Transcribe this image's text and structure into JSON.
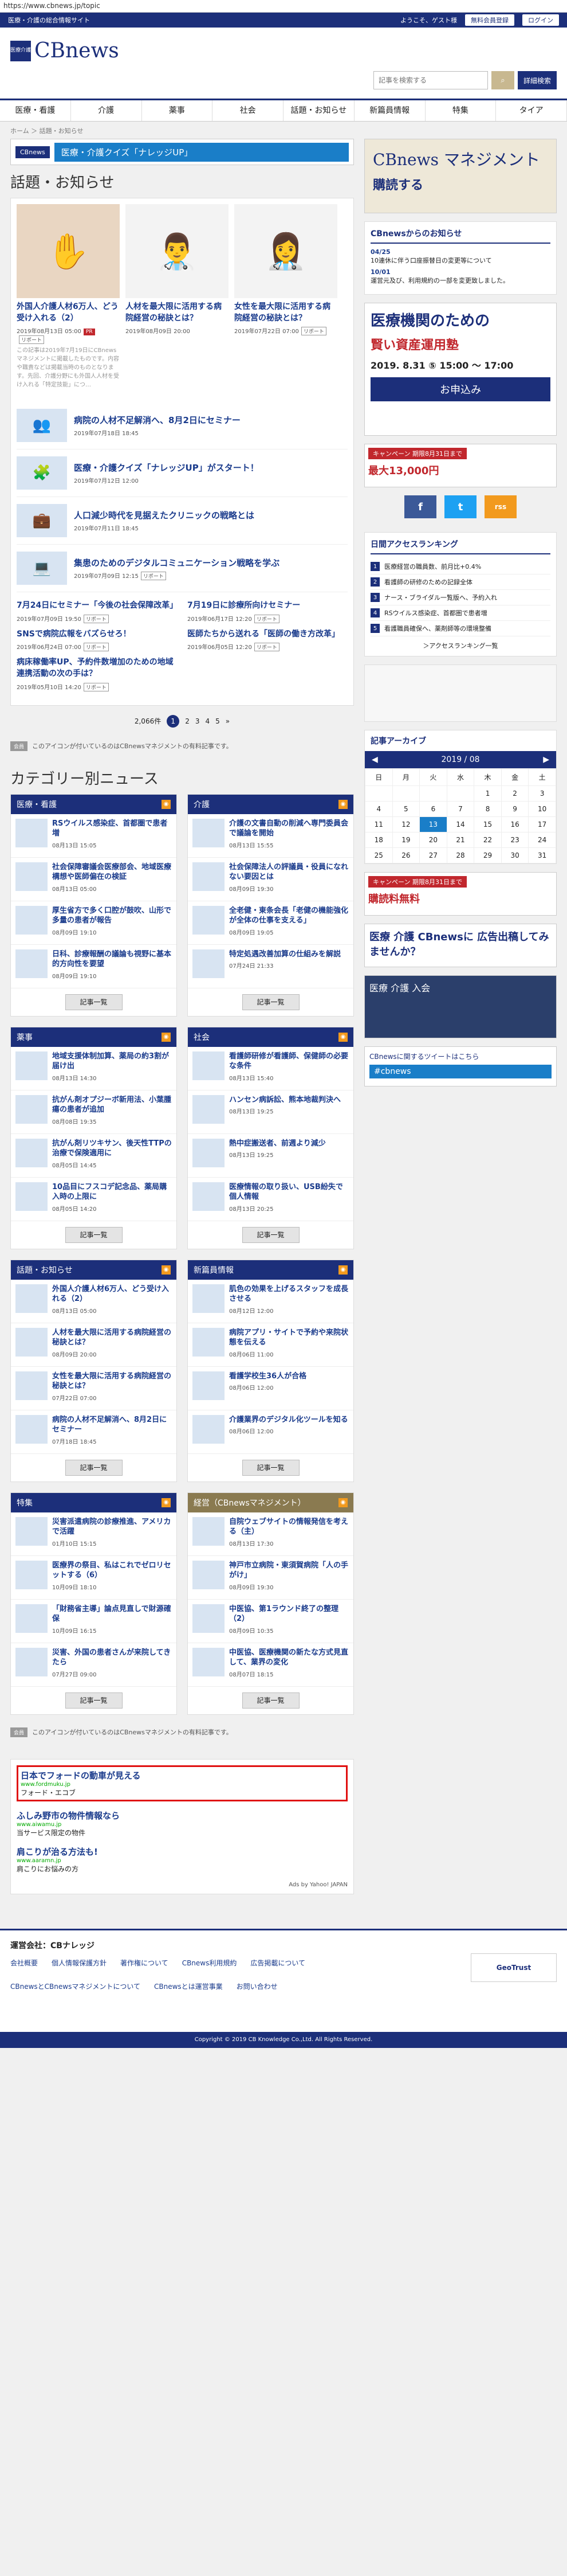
{
  "url": "https://www.cbnews.jp/topic",
  "topbar": {
    "site_tagline": "医療・介護の総合情報サイト",
    "welcome": "ようこそ、ゲスト様",
    "register": "無料会員登録",
    "login": "ログイン"
  },
  "logo": {
    "mark": "医療介護",
    "name": "CBnews"
  },
  "search": {
    "placeholder": "記事を検索する",
    "detail": "詳細検索"
  },
  "nav": [
    "医療・看護",
    "介護",
    "薬事",
    "社会",
    "話題・お知らせ",
    "新篇員情報",
    "特集",
    "タイア"
  ],
  "breadcrumb": "ホーム ＞ 話題・お知らせ",
  "quiz_banner": {
    "logo": "CBnews",
    "text": "医療・介護クイズ「ナレッジUP」"
  },
  "page_title": "話題・お知らせ",
  "featured": [
    {
      "title": "外国人介護人材6万人、どう受け入れる（2）",
      "date": "2019年08月13日 05:00",
      "tag": "リポート",
      "badge": "PR",
      "excerpt": "この記事は2019年7月19日にCBnewsマネジメントに掲載したものです。内容や職責などは掲載当時のものとなります。先回、介護分野にも外国人人材を受け入れる「特定技能」につ…",
      "icon": "✋"
    },
    {
      "title": "人材を最大限に活用する病院経営の秘訣とは？",
      "date": "2019年08月09日 20:00",
      "tag": "",
      "badge": "",
      "excerpt": "",
      "icon": "👨‍⚕️"
    },
    {
      "title": "女性を最大限に活用する病院経営の秘訣とは？",
      "date": "2019年07月22日 07:00",
      "tag": "リポート",
      "badge": "",
      "excerpt": "",
      "icon": "👩‍⚕️"
    }
  ],
  "list_items": [
    {
      "title": "病院の人材不足解消へ、8月2日にセミナー",
      "date": "2019年07月18日 18:45",
      "tag": "",
      "icon": "👥"
    },
    {
      "title": "医療・介護クイズ「ナレッジUP」がスタート！",
      "date": "2019年07月12日 12:00",
      "tag": "",
      "icon": "🧩"
    },
    {
      "title": "人口減少時代を見据えたクリニックの戦略とは",
      "date": "2019年07月11日 18:45",
      "tag": "",
      "icon": "💼"
    },
    {
      "title": "集患のためのデジタルコミュニケーション戦略を学ぶ",
      "date": "2019年07月09日 12:15",
      "tag": "リポート",
      "icon": "💻"
    }
  ],
  "grid_items": [
    {
      "title": "7月24日にセミナー「今後の社会保障改革」",
      "date": "2019年07月09日 19:50",
      "tag": "リポート"
    },
    {
      "title": "7月19日に診療所向けセミナー",
      "date": "2019年06月17日 12:20",
      "tag": "リポート"
    },
    {
      "title": "SNSで病院広報をバズらせろ！",
      "date": "2019年06月24日 07:00",
      "tag": "リポート"
    },
    {
      "title": "医師たちから送れる「医師の働き方改革」",
      "date": "2019年06月05日 12:20",
      "tag": "リポート"
    },
    {
      "title": "病床稼働率UP、予約件数増加のための地域連携活動の次の手は？",
      "date": "2019年05月10日 14:20",
      "tag": "リポート"
    }
  ],
  "pager": {
    "total": "2,066件",
    "pages": [
      "1",
      "2",
      "3",
      "4",
      "5"
    ],
    "next": "»"
  },
  "note_badge": "会員",
  "note_text": "このアイコンが付いているのはCBnewsマネジメントの有料記事です。",
  "category_title": "カテゴリー別ニュース",
  "categories": [
    {
      "name": "医療・看護",
      "items": [
        {
          "t": "RSウイルス感染症、首都圏で患者増",
          "d": "08月13日 15:05"
        },
        {
          "t": "社会保障審議会医療部会、地域医療構想や医師偏在の検証",
          "d": "08月13日 05:00"
        },
        {
          "t": "厚生省方で多く口腔が鼓吹、山形で多量の患者が報告",
          "d": "08月09日 19:10"
        },
        {
          "t": "日科、診療報酬の議論も視野に基本的方向性を要望",
          "d": "08月09日 19:10"
        }
      ]
    },
    {
      "name": "介護",
      "items": [
        {
          "t": "介護の文書自動の削減へ専門委員会で議論を開始",
          "d": "08月13日 15:55"
        },
        {
          "t": "社会保障法人の評議員・役員になれない要因とは",
          "d": "08月09日 19:30"
        },
        {
          "t": "全老健・東条会長「老健の機能強化が全体の仕事を支える」",
          "d": "08月09日 19:05"
        },
        {
          "t": "特定処遇改善加算の仕組みを解説",
          "d": "07月24日 21:33"
        }
      ]
    },
    {
      "name": "薬事",
      "items": [
        {
          "t": "地域支援体制加算、薬局の約3割が届け出",
          "d": "08月13日 14:30"
        },
        {
          "t": "抗がん剤オプジーボ新用法、小葉腫瘍の患者が追加",
          "d": "08月08日 19:35"
        },
        {
          "t": "抗がん剤リツキサン、後天性TTPの治療で保険適用に",
          "d": "08月05日 14:45"
        },
        {
          "t": "10品目にフスコデ記念品、薬局購入時の上限に",
          "d": "08月05日 14:20"
        }
      ]
    },
    {
      "name": "社会",
      "items": [
        {
          "t": "看護師研修が看護師、保健師の必要な条件",
          "d": "08月13日 15:40"
        },
        {
          "t": "ハンセン病訴訟、熊本地裁判決へ",
          "d": "08月13日 19:25"
        },
        {
          "t": "熱中症搬送者、前週より減少",
          "d": "08月13日 19:25"
        },
        {
          "t": "医療情報の取り扱い、USB紛失で個人情報",
          "d": "08月13日 20:25"
        }
      ]
    },
    {
      "name": "話題・お知らせ",
      "items": [
        {
          "t": "外国人介護人材6万人、どう受け入れる（2）",
          "d": "08月13日 05:00"
        },
        {
          "t": "人材を最大限に活用する病院経営の秘訣とは？",
          "d": "08月09日 20:00"
        },
        {
          "t": "女性を最大限に活用する病院経営の秘訣とは？",
          "d": "07月22日 07:00"
        },
        {
          "t": "病院の人材不足解消へ、8月2日にセミナー",
          "d": "07月18日 18:45"
        }
      ]
    },
    {
      "name": "新篇員情報",
      "items": [
        {
          "t": "肌色の効果を上げるスタッフを成長させる",
          "d": "08月12日 12:00"
        },
        {
          "t": "病院アプリ・サイトで予約や来院状態を伝える",
          "d": "08月06日 11:00"
        },
        {
          "t": "看護学校生36人が合格",
          "d": "08月06日 12:00"
        },
        {
          "t": "介護業界のデジタル化ツールを知る",
          "d": "08月06日 12:00"
        }
      ]
    },
    {
      "name": "特集",
      "items": [
        {
          "t": "災害派遣病院の診療推進、アメリカで活躍",
          "d": "01月10日 15:15"
        },
        {
          "t": "医療界の祭目、私はこれでゼロリセットする（6）",
          "d": "10月09日 18:10"
        },
        {
          "t": "「財務省主導」論点見直しで財源確保",
          "d": "10月09日 16:15"
        },
        {
          "t": "災害、外国の患者さんが来院してきたら",
          "d": "07月27日 09:00"
        }
      ]
    },
    {
      "name": "経営（CBnewsマネジメント）",
      "items": [
        {
          "t": "自院ウェブサイトの情報発信を考える（主）",
          "d": "08月13日 17:30"
        },
        {
          "t": "神戸市立病院・東須賀病院「人の手がけ」",
          "d": "08月09日 19:30"
        },
        {
          "t": "中医協、第1ラウンド終了の整理（2）",
          "d": "08月09日 10:35"
        },
        {
          "t": "中医協、医療機関の新たな方式見直して、業界の変化",
          "d": "08月07日 18:15"
        }
      ]
    }
  ],
  "more_label": "記事一覧",
  "side": {
    "mgmt_banner": {
      "title": "CBnews マネジメント",
      "cta": "購読する"
    },
    "news_title": "CBnewsからのお知らせ",
    "news": [
      {
        "date": "04/25",
        "text": "10連休に伴う口座振替日の変更等について"
      },
      {
        "date": "10/01",
        "text": "運営元及び、利用規約の一部を変更致しました。"
      }
    ],
    "ad1": {
      "t1": "医療機関のための",
      "t2": "賢い資産運用塾",
      "date": "2019. 8.31 ⑤ 15:00 ～ 17:00",
      "cta": "お申込み"
    },
    "campaign": {
      "label": "キャンペーン 期限8月31日まで",
      "text": "最大13,000円"
    },
    "social": [
      "f",
      "t",
      "rss"
    ],
    "ranking_title": "日間アクセスランキング",
    "ranking": [
      "医療経営の職員数、前月比+0.4%",
      "看護師の研修のための記録全体",
      "ナース・ブライダル一覧版へ、予約入れ",
      "RSウイルス感染症、首都圏で患者増",
      "看護職員確保へ、薬剤師等の環境整備"
    ],
    "ranking_link": "＞アクセスランキング一覧",
    "archive_title": "記事アーカイブ",
    "calendar": {
      "month": "2019 / 08",
      "weekdays": [
        "日",
        "月",
        "火",
        "水",
        "木",
        "金",
        "土"
      ],
      "weeks": [
        [
          "",
          "",
          "",
          "",
          "1",
          "2",
          "3"
        ],
        [
          "4",
          "5",
          "6",
          "7",
          "8",
          "9",
          "10"
        ],
        [
          "11",
          "12",
          "13",
          "14",
          "15",
          "16",
          "17"
        ],
        [
          "18",
          "19",
          "20",
          "21",
          "22",
          "23",
          "24"
        ],
        [
          "25",
          "26",
          "27",
          "28",
          "29",
          "30",
          "31"
        ]
      ],
      "today": "13"
    },
    "campaign2": {
      "label": "キャンペーン 期限8月31日まで",
      "text": "購読料無料"
    },
    "ad2": {
      "text": "医療 介護 CBnewsに 広告出稿してみませんか？"
    },
    "ad3": {
      "text": "医療 介護 入会"
    },
    "tweet_label": "CBnewsに関するツイートはこちら",
    "tweet_tag": "#cbnews"
  },
  "adsense": [
    {
      "title": "日本でフォードの動車が見える",
      "url": "www.fordmuku.jp",
      "desc": "フォード・エコブ"
    },
    {
      "title": "ふしみ野市の物件情報なら",
      "url": "www.aiwamu.jp",
      "desc": "当サービス限定の物件"
    },
    {
      "title": "肩こりが治る方法も!",
      "url": "www.aaramn.jp",
      "desc": "肩こりにお悩みの方"
    }
  ],
  "ads_by": "Ads by Yahoo! JAPAN",
  "footer": {
    "company": "運営会社：CBナレッジ",
    "links": [
      "会社概要",
      "個人情報保護方針",
      "著作権について",
      "CBnews利用規約",
      "広告掲載について",
      "CBnewsとCBnewsマネジメントについて",
      "CBnewsとは運営事業",
      "お問い合わせ"
    ],
    "secure": "GeoTrust",
    "copyright": "Copyright © 2019 CB Knowledge Co.,Ltd. All Rights Reserved."
  }
}
